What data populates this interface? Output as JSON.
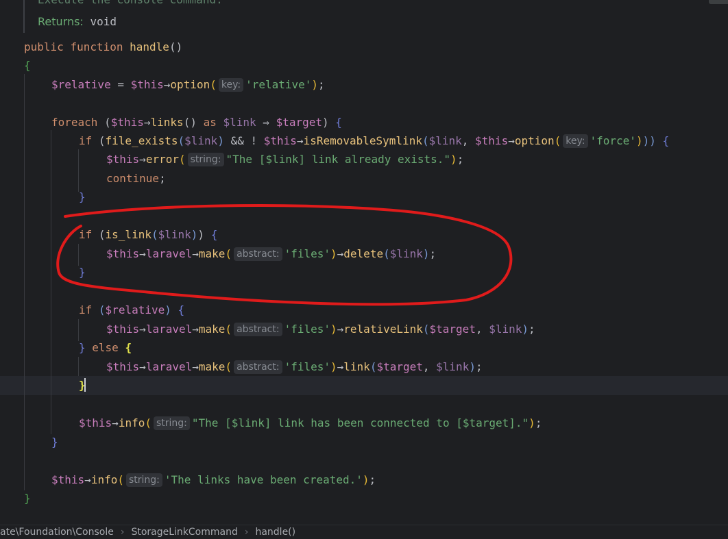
{
  "doc": {
    "summary_partial": "Execute the console command.",
    "returns_label": "Returns:",
    "returns_type": "void"
  },
  "code": {
    "kw_public": "public",
    "kw_function": "function",
    "fn_handle": "handle",
    "kw_foreach": "foreach",
    "kw_as": "as",
    "kw_if": "if",
    "kw_else": "else",
    "kw_continue": "continue",
    "var_relative": "$relative",
    "var_this": "$this",
    "var_link": "$link",
    "var_target": "$target",
    "m_option": "option",
    "m_links": "links",
    "m_error": "error",
    "m_isRemovableSymlink": "isRemovableSymlink",
    "m_laravel": "laravel",
    "m_make": "make",
    "m_delete": "delete",
    "m_relativeLink": "relativeLink",
    "m_link": "link",
    "m_info": "info",
    "fn_file_exists": "file_exists",
    "fn_is_link": "is_link",
    "hint_key": "key:",
    "hint_string": "string:",
    "hint_abstract": "abstract:",
    "str_relative": "'relative'",
    "str_force": "'force'",
    "str_files": "'files'",
    "str_already_exists": "\"The [$link] link already exists.\"",
    "str_connected": "\"The [$link] link has been connected to [$target].\"",
    "str_created": "'The links have been created.'"
  },
  "breadcrumb": {
    "items": [
      "ate\\Foundation\\Console",
      "StorageLinkCommand",
      "handle()"
    ],
    "separator": "›"
  },
  "annotation": {
    "color": "#e01b1b",
    "shape": "freehand-circle"
  }
}
